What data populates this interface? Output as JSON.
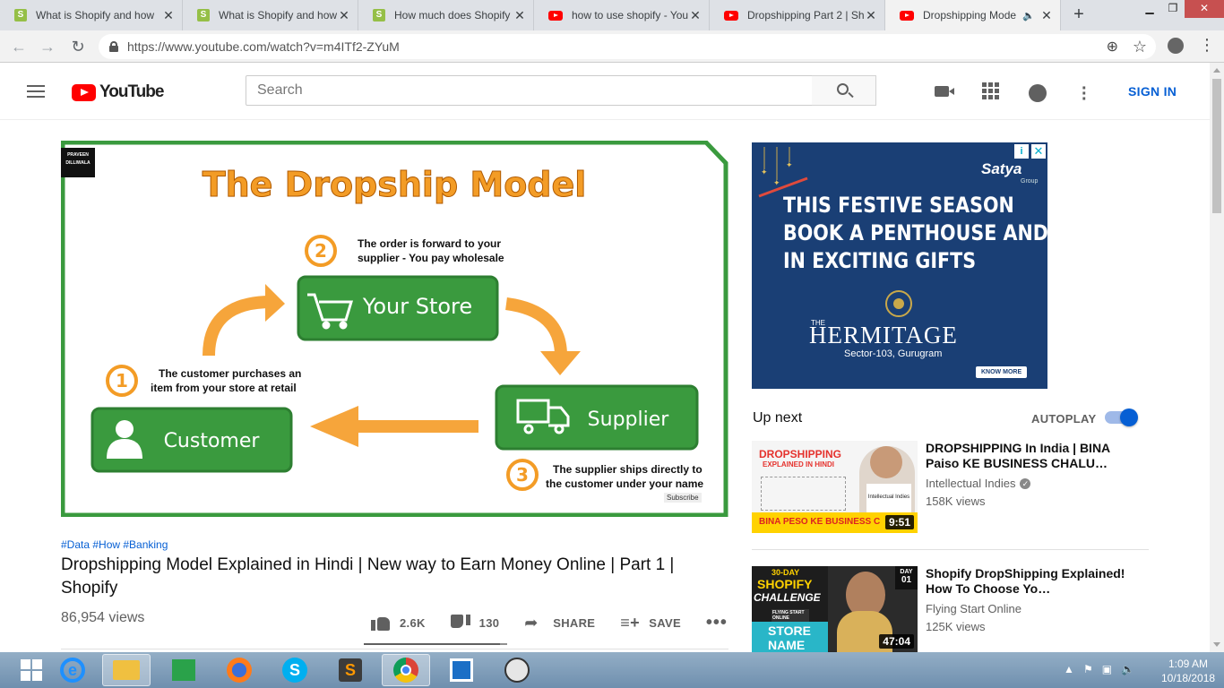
{
  "browser": {
    "tabs": [
      {
        "title": "What is Shopify and how",
        "icon": "shopify-icon"
      },
      {
        "title": "What is Shopify and how",
        "icon": "shopify-icon"
      },
      {
        "title": "How much does Shopify",
        "icon": "shopify-icon"
      },
      {
        "title": "how to use shopify - You",
        "icon": "youtube-icon"
      },
      {
        "title": "Dropshipping Part 2 | Sh",
        "icon": "youtube-icon"
      },
      {
        "title": "Dropshipping Mode",
        "icon": "youtube-icon",
        "active": true,
        "audio": true
      }
    ],
    "url": "https://www.youtube.com/watch?v=m4ITf2-ZYuM"
  },
  "youtube": {
    "logo_text": "YouTube",
    "search_placeholder": "Search",
    "sign_in": "SIGN IN"
  },
  "video": {
    "tags": "#Data #How #Banking",
    "title": "Dropshipping Model Explained in Hindi | New way to Earn Money Online | Part 1 | Shopify",
    "views": "86,954 views",
    "likes": "2.6K",
    "dislikes": "130",
    "share_label": "SHARE",
    "save_label": "SAVE",
    "like_ratio": 0.95,
    "frame": {
      "brand_line1": "PRAVEEN",
      "brand_line2": "DILLIWALA",
      "heading": "The Dropship Model",
      "step2_num": "2",
      "step2_text_line1": "The order is forward to your",
      "step2_text_line2": "supplier - You pay wholesale",
      "store_label": "Your Store",
      "step1_num": "1",
      "step1_text_line1": "The customer purchases an",
      "step1_text_line2": "item from your store at retail",
      "customer_label": "Customer",
      "supplier_label": "Supplier",
      "step3_num": "3",
      "step3_text_line1": "The supplier ships directly to",
      "step3_text_line2": "the customer under your name",
      "watermark": "Subscribe"
    }
  },
  "ad": {
    "brand": "Satya",
    "brand_sub": "Group",
    "headline_1": "THIS FESTIVE SEASON",
    "headline_2": "BOOK A PENTHOUSE AND",
    "headline_3": "IN EXCITING GIFTS",
    "project_pre": "THE",
    "project": "HERMITAGE",
    "location": "Sector-103, Gurugram",
    "cta": "KNOW MORE",
    "info": "i",
    "close": "✕"
  },
  "sidebar": {
    "up_next": "Up next",
    "autoplay": "AUTOPLAY",
    "autoplay_on": true,
    "items": [
      {
        "title": "DROPSHIPPING In India | BINA Paiso KE BUSINESS CHALU…",
        "channel": "Intellectual Indies",
        "verified": true,
        "views": "158K views",
        "duration": "9:51",
        "thumb_line1": "DROPSHIPPING",
        "thumb_line2": "EXPLAINED IN HINDI",
        "thumb_bottom": "BINA PESO KE BUSINESS C",
        "thumb_shirt": "Intellectual Indies"
      },
      {
        "title": "Shopify DropShipping Explained! How To Choose Yo…",
        "channel": "Flying Start Online",
        "verified": false,
        "views": "125K views",
        "duration": "47:04",
        "thumb_line1": "30-DAY",
        "thumb_line2": "SHOPIFY",
        "thumb_line3": "CHALLENGE",
        "thumb_line4": "STORE",
        "thumb_line5": "NAME",
        "thumb_day": "DAY",
        "thumb_day_num": "01",
        "thumb_badge": "FLYING START ONLINE"
      }
    ]
  },
  "taskbar": {
    "time": "1:09 AM",
    "date": "10/18/2018"
  }
}
